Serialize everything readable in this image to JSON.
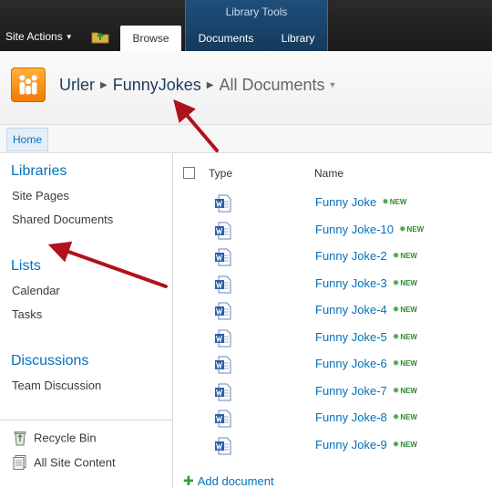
{
  "ribbon": {
    "contextual_group": "Library Tools",
    "site_actions": "Site Actions",
    "tabs": [
      {
        "label": "Browse",
        "selected": true
      },
      {
        "label": "Documents",
        "selected": false
      },
      {
        "label": "Library",
        "selected": false
      }
    ]
  },
  "breadcrumb": {
    "site": "Urler",
    "list": "FunnyJokes",
    "view": "All Documents"
  },
  "topnav": {
    "home": "Home"
  },
  "leftnav": {
    "libraries_heading": "Libraries",
    "libraries": [
      "Site Pages",
      "Shared Documents"
    ],
    "lists_heading": "Lists",
    "lists": [
      "Calendar",
      "Tasks"
    ],
    "discussions_heading": "Discussions",
    "discussions": [
      "Team Discussion"
    ],
    "recycle_bin": "Recycle Bin",
    "all_site_content": "All Site Content"
  },
  "list": {
    "columns": {
      "type": "Type",
      "name": "Name"
    },
    "new_badge": "NEW",
    "items": [
      {
        "name": "Funny Joke",
        "icon": "word-doc-icon",
        "is_new": true
      },
      {
        "name": "Funny Joke-10",
        "icon": "word-doc-icon",
        "is_new": true
      },
      {
        "name": "Funny Joke-2",
        "icon": "word-doc-icon",
        "is_new": true
      },
      {
        "name": "Funny Joke-3",
        "icon": "word-doc-icon",
        "is_new": true
      },
      {
        "name": "Funny Joke-4",
        "icon": "word-doc-icon",
        "is_new": true
      },
      {
        "name": "Funny Joke-5",
        "icon": "word-doc-icon",
        "is_new": true
      },
      {
        "name": "Funny Joke-6",
        "icon": "word-doc-icon",
        "is_new": true
      },
      {
        "name": "Funny Joke-7",
        "icon": "word-doc-icon",
        "is_new": true
      },
      {
        "name": "Funny Joke-8",
        "icon": "word-doc-icon",
        "is_new": true
      },
      {
        "name": "Funny Joke-9",
        "icon": "word-doc-icon",
        "is_new": true
      }
    ],
    "add_document": "Add document"
  },
  "colors": {
    "link": "#0072bc",
    "ribbon_dark": "#1a1a1a",
    "contextual_tab": "#1f4f7a",
    "annotation_arrow": "#b0121b"
  }
}
